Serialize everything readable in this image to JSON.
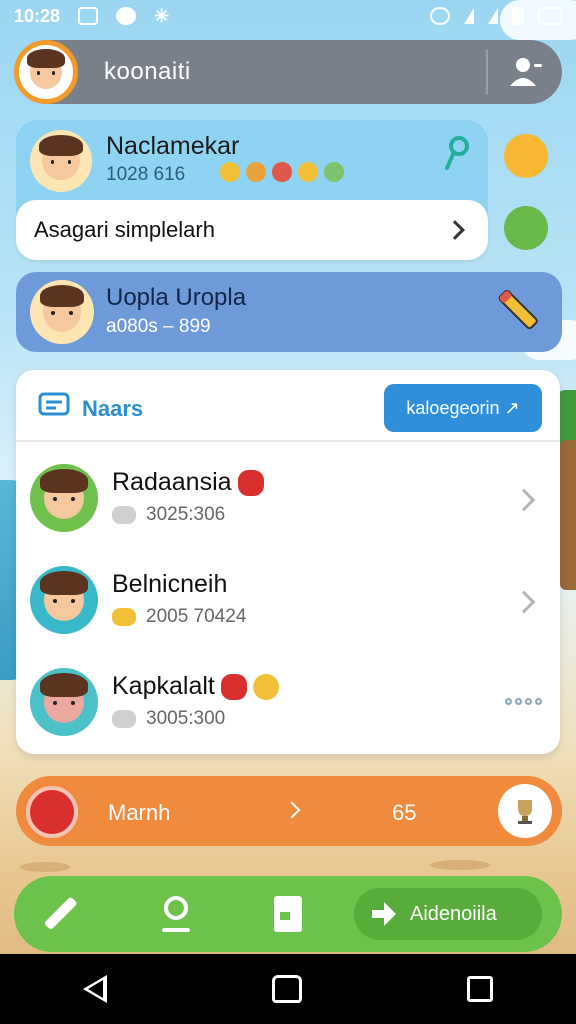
{
  "status_bar": {
    "time": "10:28"
  },
  "account": {
    "name": "koonaiti"
  },
  "profile_card": {
    "name": "Naclamekar",
    "meta": "1028 616",
    "link_label": "Asagari simplelarh"
  },
  "secondary_card": {
    "name": "Uopla Uropla",
    "meta": "a080s – 899"
  },
  "friends": {
    "title": "Naars",
    "action_label": "kaloegeorin ↗",
    "items": [
      {
        "name": "Radaansia",
        "sub": "3025:306",
        "trailing": "chevron"
      },
      {
        "name": "Belnicneih",
        "sub": "2005 70424",
        "trailing": "chevron"
      },
      {
        "name": "Kapkalalt",
        "sub": "3005:300",
        "trailing": "more"
      }
    ]
  },
  "march": {
    "label": "Marnh",
    "value": "65"
  },
  "actions": {
    "primary_label": "Aidenoiila"
  },
  "colors": {
    "accent_blue": "#2f8fdb",
    "orange": "#f08a3c",
    "green": "#6cc24a",
    "card_blue": "#8fd3f2",
    "card_indigo": "#6f9ad9"
  }
}
